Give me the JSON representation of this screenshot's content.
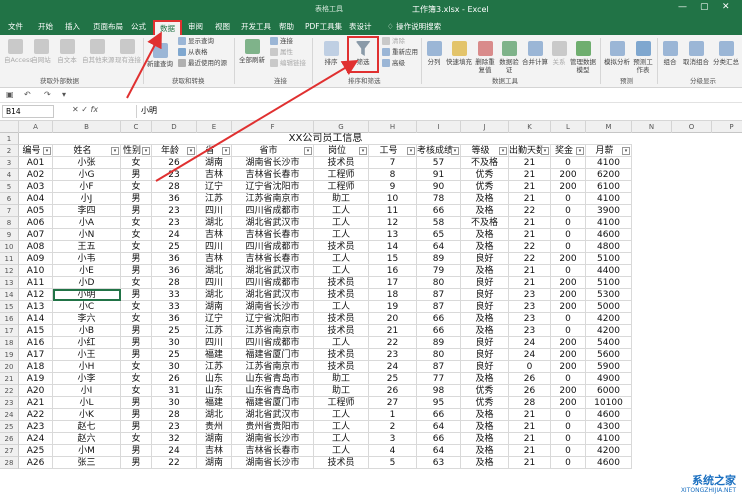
{
  "window": {
    "context_tab": "表格工具",
    "title": "工作簿3.xlsx - Excel"
  },
  "tabs": [
    "文件",
    "开始",
    "插入",
    "页面布局",
    "公式",
    "数据",
    "审阅",
    "视图",
    "开发工具",
    "帮助",
    "PDF工具集",
    "表设计",
    "操作说明搜索"
  ],
  "ribbon": {
    "get_external_data": [
      "自Access",
      "自网站",
      "自文本",
      "自其他来源",
      "现有连接"
    ],
    "get_external_data_group": "获取外部数据",
    "new_query": "新建查询",
    "query_small": [
      "显示查询",
      "从表格",
      "最近使用的源"
    ],
    "get_transform_group": "获取和转换",
    "refresh_all": "全部刷新",
    "connections_small": [
      "连接",
      "属性",
      "编辑链接"
    ],
    "connections_group": "连接",
    "sort": "排序",
    "filter": "筛选",
    "filter_small": [
      "清除",
      "重新应用",
      "高级"
    ],
    "sort_filter_group": "排序和筛选",
    "data_tools": [
      "分列",
      "快速填充",
      "删除重复值",
      "数据验证",
      "合并计算",
      "关系",
      "管理数据模型"
    ],
    "data_tools_group": "数据工具",
    "forecast": [
      "模拟分析",
      "预测工作表"
    ],
    "forecast_group": "预测",
    "outline": [
      "组合",
      "取消组合",
      "分类汇总"
    ],
    "outline_group": "分级显示"
  },
  "formula_bar": {
    "name_box": "B14",
    "fx": "fx",
    "content": "小明"
  },
  "columns": [
    "A",
    "B",
    "C",
    "D",
    "E",
    "F",
    "G",
    "H",
    "I",
    "J",
    "K",
    "L",
    "M",
    "N",
    "O",
    "P",
    "Q"
  ],
  "sheet": {
    "title": "XX公司员工信息",
    "headers": [
      "编号",
      "姓名",
      "性别",
      "年龄",
      "省",
      "省市",
      "岗位",
      "工号",
      "考核成绩",
      "等级",
      "出勤天数",
      "奖金",
      "月薪"
    ],
    "rows": [
      [
        "A01",
        "小张",
        "女",
        "26",
        "湖南",
        "湖南省长沙市",
        "技术员",
        "7",
        "57",
        "不及格",
        "21",
        "0",
        "4100"
      ],
      [
        "A02",
        "小G",
        "男",
        "23",
        "吉林",
        "吉林省长春市",
        "工程师",
        "8",
        "91",
        "优秀",
        "21",
        "200",
        "6200"
      ],
      [
        "A03",
        "小F",
        "女",
        "28",
        "辽宁",
        "辽宁省沈阳市",
        "工程师",
        "9",
        "90",
        "优秀",
        "21",
        "200",
        "6100"
      ],
      [
        "A04",
        "小J",
        "男",
        "36",
        "江苏",
        "江苏省南京市",
        "助工",
        "10",
        "78",
        "及格",
        "21",
        "0",
        "4100"
      ],
      [
        "A05",
        "李四",
        "男",
        "23",
        "四川",
        "四川省成都市",
        "工人",
        "11",
        "66",
        "及格",
        "22",
        "0",
        "3900"
      ],
      [
        "A06",
        "小A",
        "女",
        "23",
        "湖北",
        "湖北省武汉市",
        "工人",
        "12",
        "58",
        "不及格",
        "21",
        "0",
        "4100"
      ],
      [
        "A07",
        "小N",
        "女",
        "24",
        "吉林",
        "吉林省长春市",
        "工人",
        "13",
        "65",
        "及格",
        "21",
        "0",
        "4600"
      ],
      [
        "A08",
        "王五",
        "女",
        "25",
        "四川",
        "四川省成都市",
        "技术员",
        "14",
        "64",
        "及格",
        "22",
        "0",
        "4800"
      ],
      [
        "A09",
        "小韦",
        "男",
        "36",
        "吉林",
        "吉林省长春市",
        "工人",
        "15",
        "89",
        "良好",
        "22",
        "200",
        "5100"
      ],
      [
        "A10",
        "小E",
        "男",
        "36",
        "湖北",
        "湖北省武汉市",
        "工人",
        "16",
        "79",
        "及格",
        "21",
        "0",
        "4400"
      ],
      [
        "A11",
        "小D",
        "女",
        "28",
        "四川",
        "四川省成都市",
        "技术员",
        "17",
        "80",
        "良好",
        "21",
        "200",
        "5100"
      ],
      [
        "A12",
        "小明",
        "男",
        "33",
        "湖北",
        "湖北省武汉市",
        "技术员",
        "18",
        "87",
        "良好",
        "23",
        "200",
        "5300"
      ],
      [
        "A13",
        "小C",
        "女",
        "33",
        "湖南",
        "湖南省长沙市",
        "工人",
        "19",
        "87",
        "良好",
        "23",
        "200",
        "5000"
      ],
      [
        "A14",
        "李六",
        "女",
        "36",
        "辽宁",
        "辽宁省沈阳市",
        "技术员",
        "20",
        "66",
        "及格",
        "23",
        "0",
        "4200"
      ],
      [
        "A15",
        "小B",
        "男",
        "25",
        "江苏",
        "江苏省南京市",
        "技术员",
        "21",
        "66",
        "及格",
        "23",
        "0",
        "4200"
      ],
      [
        "A16",
        "小红",
        "男",
        "30",
        "四川",
        "四川省成都市",
        "工人",
        "22",
        "89",
        "良好",
        "24",
        "200",
        "5400"
      ],
      [
        "A17",
        "小王",
        "男",
        "25",
        "福建",
        "福建省厦门市",
        "技术员",
        "23",
        "80",
        "良好",
        "24",
        "200",
        "5600"
      ],
      [
        "A18",
        "小H",
        "女",
        "30",
        "江苏",
        "江苏省南京市",
        "技术员",
        "24",
        "87",
        "良好",
        "0",
        "200",
        "5900"
      ],
      [
        "A19",
        "小李",
        "女",
        "26",
        "山东",
        "山东省青岛市",
        "助工",
        "25",
        "77",
        "及格",
        "26",
        "0",
        "4900"
      ],
      [
        "A20",
        "小I",
        "女",
        "31",
        "山东",
        "山东省青岛市",
        "助工",
        "26",
        "98",
        "优秀",
        "26",
        "200",
        "6000"
      ],
      [
        "A21",
        "小L",
        "男",
        "30",
        "福建",
        "福建省厦门市",
        "工程师",
        "27",
        "95",
        "优秀",
        "28",
        "200",
        "10100"
      ],
      [
        "A22",
        "小K",
        "男",
        "28",
        "湖北",
        "湖北省武汉市",
        "工人",
        "1",
        "66",
        "及格",
        "21",
        "0",
        "4600"
      ],
      [
        "A23",
        "赵七",
        "男",
        "23",
        "贵州",
        "贵州省贵阳市",
        "工人",
        "2",
        "64",
        "及格",
        "21",
        "0",
        "4300"
      ],
      [
        "A24",
        "赵六",
        "女",
        "32",
        "湖南",
        "湖南省长沙市",
        "工人",
        "3",
        "66",
        "及格",
        "21",
        "0",
        "4100"
      ],
      [
        "A25",
        "小M",
        "男",
        "24",
        "吉林",
        "吉林省长春市",
        "工人",
        "4",
        "64",
        "及格",
        "21",
        "0",
        "4200"
      ],
      [
        "A26",
        "张三",
        "男",
        "22",
        "湖南",
        "湖南省长沙市",
        "技术员",
        "5",
        "63",
        "及格",
        "21",
        "0",
        "4600"
      ]
    ]
  },
  "watermark": {
    "line1": "系统之家",
    "line2": "XITONGZHIJIA.NET"
  },
  "colors": {
    "excel_green": "#217346",
    "highlight_red": "#e03030"
  }
}
